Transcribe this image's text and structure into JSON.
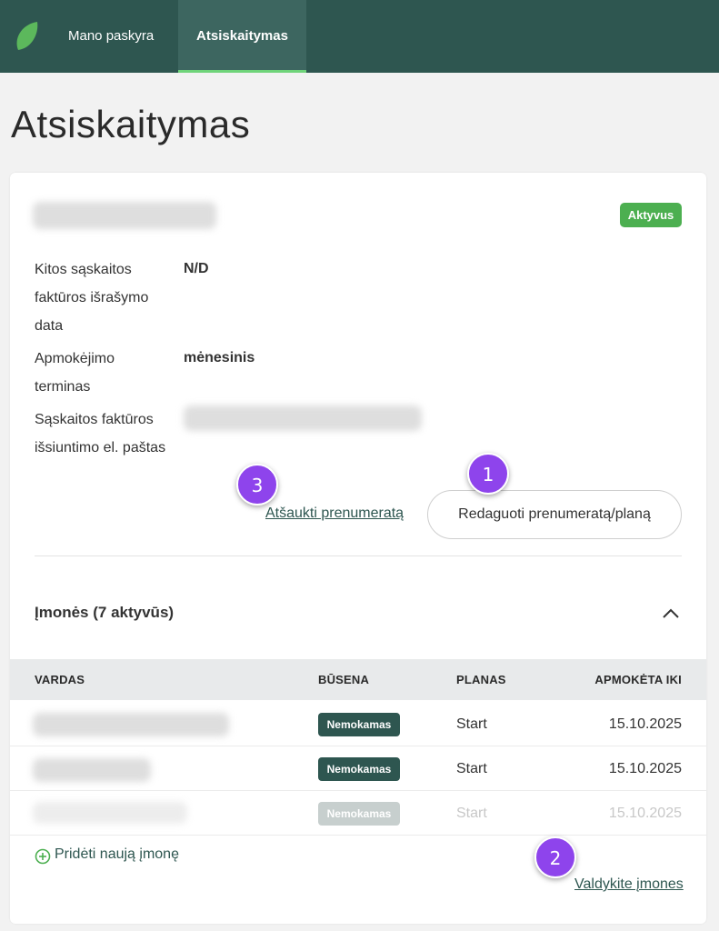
{
  "nav": {
    "items": [
      {
        "label": "Mano paskyra"
      },
      {
        "label": "Atsiskaitymas"
      }
    ]
  },
  "page": {
    "title": "Atsiskaitymas"
  },
  "subscription": {
    "status": "Aktyvus",
    "fields": [
      {
        "label": "Kitos sąskaitos faktūros išrašymo data",
        "value": "N/D"
      },
      {
        "label": "Apmokėjimo terminas",
        "value": "mėnesinis"
      },
      {
        "label": "Sąskaitos faktūros išsiuntimo el. paštas",
        "value": ""
      }
    ],
    "edit_label": "Redaguoti prenumeratą/planą",
    "cancel_label": "Atšaukti prenumeratą"
  },
  "markers": [
    "1",
    "2",
    "3"
  ],
  "companies": {
    "title": "Įmonės (7 aktyvūs)",
    "columns": [
      "VARDAS",
      "BŪSENA",
      "PLANAS",
      "APMOKĖTA IKI"
    ],
    "rows": [
      {
        "status": "Nemokamas",
        "plan": "Start",
        "paid_until": "15.10.2025",
        "faded": false
      },
      {
        "status": "Nemokamas",
        "plan": "Start",
        "paid_until": "15.10.2025",
        "faded": false
      },
      {
        "status": "Nemokamas",
        "plan": "Start",
        "paid_until": "15.10.2025",
        "faded": true
      }
    ],
    "add_label": "Pridėti naują įmonę",
    "manage_label": "Valdykite įmones"
  },
  "colors": {
    "nav_bg": "#2e5650",
    "accent_green": "#4caf50",
    "marker_purple": "#8e44ec"
  }
}
